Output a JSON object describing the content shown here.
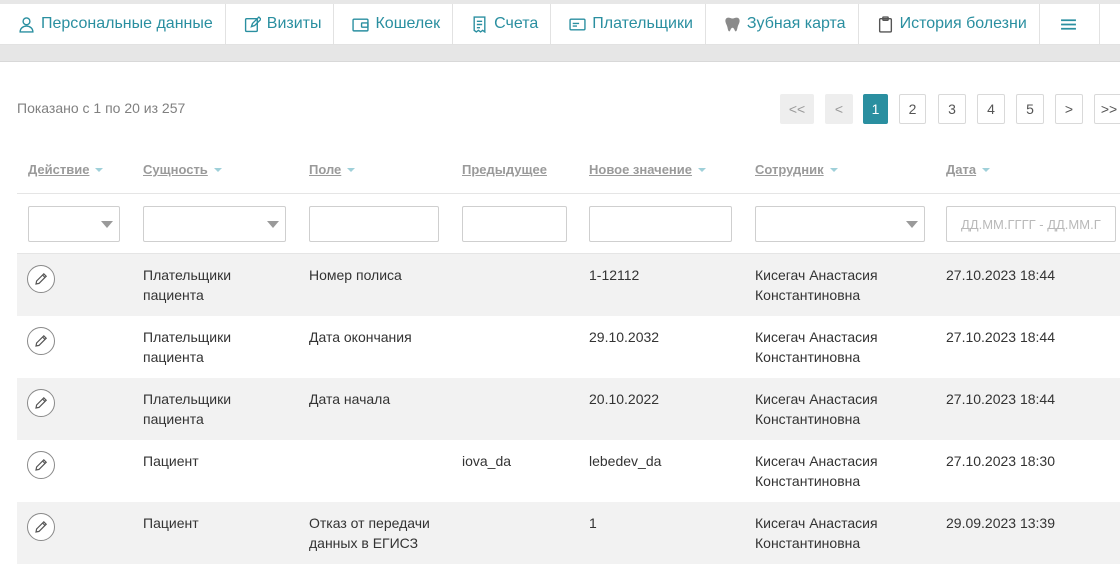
{
  "tabs": [
    {
      "label": "Персональные данные",
      "icon": "user-icon"
    },
    {
      "label": "Визиты",
      "icon": "edit-icon"
    },
    {
      "label": "Кошелек",
      "icon": "wallet-icon"
    },
    {
      "label": "Счета",
      "icon": "receipt-icon"
    },
    {
      "label": "Плательщики",
      "icon": "card-icon"
    },
    {
      "label": "Зубная карта",
      "icon": "tooth-icon"
    },
    {
      "label": "История болезни",
      "icon": "clipboard-icon"
    }
  ],
  "summary": "Показано с 1 по 20 из 257",
  "pagination": {
    "first": "<<",
    "prev": "<",
    "pages": [
      "1",
      "2",
      "3",
      "4",
      "5"
    ],
    "active": "1",
    "next": ">",
    "last": ">>"
  },
  "columns": {
    "action": "Действие",
    "entity": "Сущность",
    "field": "Поле",
    "previous": "Предыдущее",
    "new_value": "Новое значение",
    "employee": "Сотрудник",
    "date": "Дата"
  },
  "filters": {
    "date_placeholder": "ДД.ММ.ГГГГ - ДД.ММ.ГГГГ"
  },
  "rows": [
    {
      "entity_1": "Плательщики",
      "entity_2": "пациента",
      "field_1": "Номер полиса",
      "field_2": "",
      "previous": "",
      "new_value": "1-12112",
      "employee_1": "Кисегач Анастасия",
      "employee_2": "Константиновна",
      "date": "27.10.2023 18:44"
    },
    {
      "entity_1": "Плательщики",
      "entity_2": "пациента",
      "field_1": "Дата окончания",
      "field_2": "",
      "previous": "",
      "new_value": "29.10.2032",
      "employee_1": "Кисегач Анастасия",
      "employee_2": "Константиновна",
      "date": "27.10.2023 18:44"
    },
    {
      "entity_1": "Плательщики",
      "entity_2": "пациента",
      "field_1": "Дата начала",
      "field_2": "",
      "previous": "",
      "new_value": "20.10.2022",
      "employee_1": "Кисегач Анастасия",
      "employee_2": "Константиновна",
      "date": "27.10.2023 18:44"
    },
    {
      "entity_1": "Пациент",
      "entity_2": "",
      "field_1": "",
      "field_2": "",
      "previous": "iova_da",
      "new_value": "lebedev_da",
      "employee_1": "Кисегач Анастасия",
      "employee_2": "Константиновна",
      "date": "27.10.2023 18:30"
    },
    {
      "entity_1": "Пациент",
      "entity_2": "",
      "field_1": "Отказ от передачи",
      "field_2": "данных в ЕГИСЗ",
      "previous": "",
      "new_value": "1",
      "employee_1": "Кисегач Анастасия",
      "employee_2": "Константиновна",
      "date": "29.09.2023 13:39"
    }
  ],
  "colors": {
    "accent": "#2a8fa0",
    "row_alt": "#f2f2f2",
    "header_text": "#9a9a9a"
  }
}
